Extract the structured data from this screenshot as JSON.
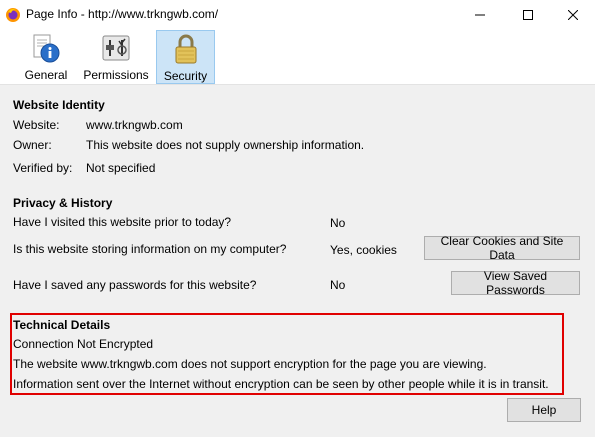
{
  "window": {
    "title": "Page Info - http://www.trkngwb.com/"
  },
  "tabs": [
    {
      "label": "General"
    },
    {
      "label": "Permissions"
    },
    {
      "label": "Security"
    }
  ],
  "identity": {
    "heading": "Website Identity",
    "website_label": "Website:",
    "website_value": "www.trkngwb.com",
    "owner_label": "Owner:",
    "owner_value": "This website does not supply ownership information.",
    "verified_label": "Verified by:",
    "verified_value": "Not specified"
  },
  "privacy": {
    "heading": "Privacy & History",
    "q1": "Have I visited this website prior to today?",
    "a1": "No",
    "q2": "Is this website storing information on my computer?",
    "a2": "Yes, cookies",
    "clear_button": "Clear Cookies and Site Data",
    "q3": "Have I saved any passwords for this website?",
    "a3": "No",
    "passwords_button": "View Saved Passwords"
  },
  "technical": {
    "heading": "Technical Details",
    "line1": "Connection Not Encrypted",
    "line2": "The website www.trkngwb.com does not support encryption for the page you are viewing.",
    "line3": "Information sent over the Internet without encryption can be seen by other people while it is in transit."
  },
  "footer": {
    "help_button": "Help"
  },
  "colors": {
    "selected_tab_bg": "#cce4f7",
    "highlight_border": "#e00000",
    "content_bg": "#f0f0f0"
  }
}
